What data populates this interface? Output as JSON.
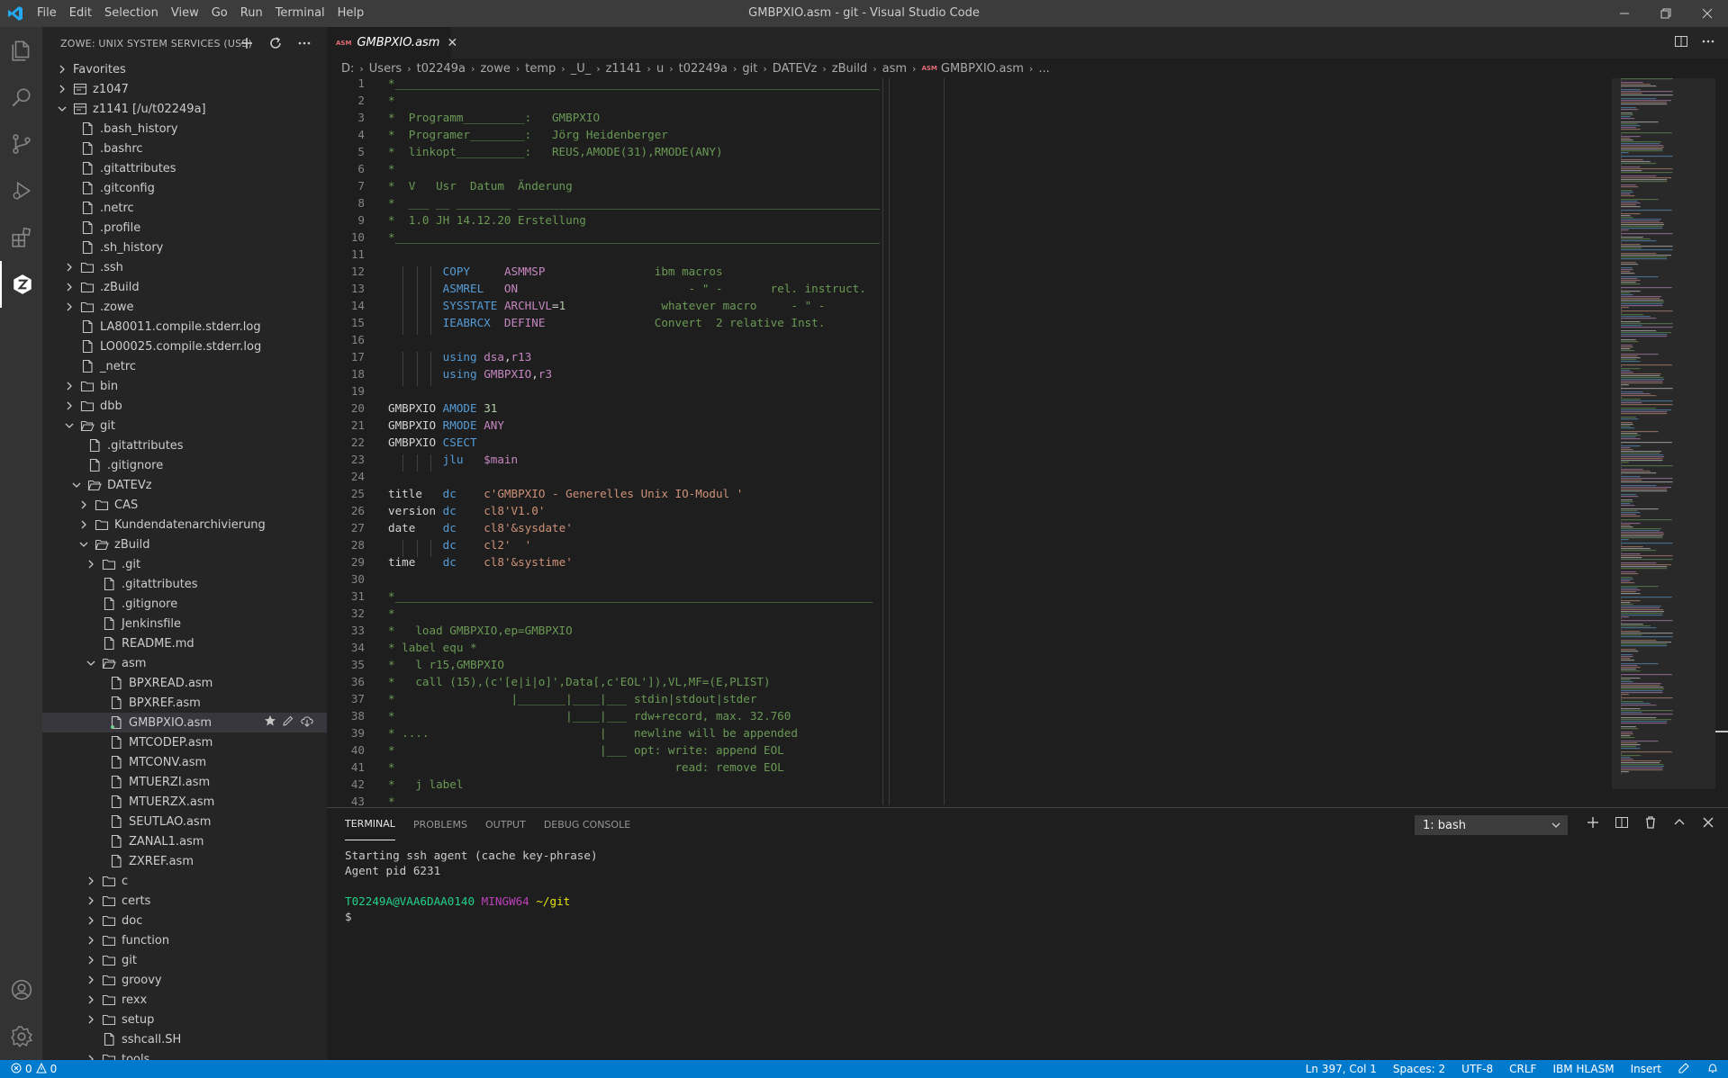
{
  "titlebar": {
    "window_title": "GMBPXIO.asm - git - Visual Studio Code",
    "menus": [
      "File",
      "Edit",
      "Selection",
      "View",
      "Go",
      "Run",
      "Terminal",
      "Help"
    ]
  },
  "activity_bar": {
    "icons": [
      "explorer-icon",
      "search-icon",
      "source-control-icon",
      "run-debug-icon",
      "extensions-icon",
      "zowe-icon"
    ],
    "bottom_icons": [
      "accounts-icon",
      "settings-gear-icon"
    ]
  },
  "sidebar": {
    "title": "ZOWE: UNIX SYSTEM SERVICES (USS)",
    "tree": [
      {
        "label": "Favorites",
        "kind": "folder-closed",
        "level": 0
      },
      {
        "label": "z1047",
        "kind": "profile-closed",
        "level": 0
      },
      {
        "label": "z1141 [/u/t02249a]",
        "kind": "profile-open",
        "level": 0
      },
      {
        "label": ".bash_history",
        "kind": "file",
        "level": 1
      },
      {
        "label": ".bashrc",
        "kind": "file",
        "level": 1
      },
      {
        "label": ".gitattributes",
        "kind": "file",
        "level": 1
      },
      {
        "label": ".gitconfig",
        "kind": "file",
        "level": 1
      },
      {
        "label": ".netrc",
        "kind": "file",
        "level": 1
      },
      {
        "label": ".profile",
        "kind": "file",
        "level": 1
      },
      {
        "label": ".sh_history",
        "kind": "file",
        "level": 1
      },
      {
        "label": ".ssh",
        "kind": "folder-closed",
        "level": 1
      },
      {
        "label": ".zBuild",
        "kind": "folder-closed",
        "level": 1
      },
      {
        "label": ".zowe",
        "kind": "folder-closed",
        "level": 1
      },
      {
        "label": "LA80011.compile.stderr.log",
        "kind": "file",
        "level": 1
      },
      {
        "label": "LO00025.compile.stderr.log",
        "kind": "file",
        "level": 1
      },
      {
        "label": "_netrc",
        "kind": "file",
        "level": 1
      },
      {
        "label": "bin",
        "kind": "folder-closed",
        "level": 1
      },
      {
        "label": "dbb",
        "kind": "folder-closed",
        "level": 1
      },
      {
        "label": "git",
        "kind": "folder-open",
        "level": 1
      },
      {
        "label": ".gitattributes",
        "kind": "file",
        "level": 2
      },
      {
        "label": ".gitignore",
        "kind": "file",
        "level": 2
      },
      {
        "label": "DATEVz",
        "kind": "folder-open",
        "level": 2
      },
      {
        "label": "CAS",
        "kind": "folder-closed",
        "level": 3
      },
      {
        "label": "Kundendatenarchivierung",
        "kind": "folder-closed",
        "level": 3
      },
      {
        "label": "zBuild",
        "kind": "folder-open",
        "level": 3
      },
      {
        "label": ".git",
        "kind": "folder-closed",
        "level": 4
      },
      {
        "label": ".gitattributes",
        "kind": "file",
        "level": 4
      },
      {
        "label": ".gitignore",
        "kind": "file",
        "level": 4
      },
      {
        "label": "Jenkinsfile",
        "kind": "file",
        "level": 4
      },
      {
        "label": "README.md",
        "kind": "file",
        "level": 4
      },
      {
        "label": "asm",
        "kind": "folder-open",
        "level": 4
      },
      {
        "label": "BPXREAD.asm",
        "kind": "file",
        "level": 5
      },
      {
        "label": "BPXREF.asm",
        "kind": "file",
        "level": 5
      },
      {
        "label": "GMBPXIO.asm",
        "kind": "file",
        "level": 5,
        "selected": true
      },
      {
        "label": "MTCODEP.asm",
        "kind": "file",
        "level": 5
      },
      {
        "label": "MTCONV.asm",
        "kind": "file",
        "level": 5
      },
      {
        "label": "MTUERZI.asm",
        "kind": "file",
        "level": 5
      },
      {
        "label": "MTUERZX.asm",
        "kind": "file",
        "level": 5
      },
      {
        "label": "SEUTLAO.asm",
        "kind": "file",
        "level": 5
      },
      {
        "label": "ZANAL1.asm",
        "kind": "file",
        "level": 5
      },
      {
        "label": "ZXREF.asm",
        "kind": "file",
        "level": 5
      },
      {
        "label": "c",
        "kind": "folder-closed",
        "level": 4
      },
      {
        "label": "certs",
        "kind": "folder-closed",
        "level": 4
      },
      {
        "label": "doc",
        "kind": "folder-closed",
        "level": 4
      },
      {
        "label": "function",
        "kind": "folder-closed",
        "level": 4
      },
      {
        "label": "git",
        "kind": "folder-closed",
        "level": 4
      },
      {
        "label": "groovy",
        "kind": "folder-closed",
        "level": 4
      },
      {
        "label": "rexx",
        "kind": "folder-closed",
        "level": 4
      },
      {
        "label": "setup",
        "kind": "folder-closed",
        "level": 4
      },
      {
        "label": "sshcall.SH",
        "kind": "file",
        "level": 4
      },
      {
        "label": "tools",
        "kind": "folder-closed",
        "level": 4
      }
    ]
  },
  "editor": {
    "tab": {
      "badge": "ASM",
      "label": "GMBPXIO.asm"
    },
    "breadcrumbs": [
      "D:",
      "Users",
      "t02249a",
      "zowe",
      "temp",
      "_U_",
      "z1141",
      "u",
      "t02249a",
      "git",
      "DATEVz",
      "zBuild",
      "asm",
      "GMBPXIO.asm",
      "..."
    ],
    "lines": [
      {
        "n": "1",
        "t": "*_______________________________________________________________________",
        "c": "com"
      },
      {
        "n": "2",
        "t": "*",
        "c": "com"
      },
      {
        "n": "3",
        "t": "*  Programm_________:   GMBPXIO",
        "c": "com"
      },
      {
        "n": "4",
        "t": "*  Programer________:   Jörg Heidenberger",
        "c": "com"
      },
      {
        "n": "5",
        "t": "*  linkopt__________:   REUS,AMODE(31),RMODE(ANY)",
        "c": "com"
      },
      {
        "n": "6",
        "t": "*",
        "c": "com"
      },
      {
        "n": "7",
        "t": "*  V   Usr  Datum  Änderung",
        "c": "com"
      },
      {
        "n": "8",
        "t": "*  ___ __ ________ _____________________________________________________",
        "c": "com"
      },
      {
        "n": "9",
        "t": "*  1.0 JH 14.12.20 Erstellung",
        "c": "com"
      },
      {
        "n": "10",
        "t": "*_______________________________________________________________________",
        "c": "com"
      },
      {
        "n": "11",
        "t": "",
        "c": "com"
      },
      {
        "n": "12",
        "parts": [
          [
            "        ",
            ""
          ],
          [
            "COPY",
            "kw"
          ],
          [
            "     ",
            ""
          ],
          [
            "ASMMSP",
            "op"
          ],
          [
            "                ",
            ""
          ],
          [
            "ibm macros",
            "com"
          ]
        ]
      },
      {
        "n": "13",
        "parts": [
          [
            "        ",
            ""
          ],
          [
            "ASMREL",
            "kw"
          ],
          [
            "   ",
            ""
          ],
          [
            "ON",
            "op"
          ],
          [
            "                      ",
            ""
          ],
          [
            "   - \" -       rel. instruct.",
            "com"
          ]
        ]
      },
      {
        "n": "14",
        "parts": [
          [
            "        ",
            ""
          ],
          [
            "SYSSTATE",
            "kw"
          ],
          [
            " ",
            ""
          ],
          [
            "ARCHLVL",
            "op"
          ],
          [
            "=",
            "lbl"
          ],
          [
            "1",
            "num"
          ],
          [
            "              ",
            ""
          ],
          [
            "whatever macro     - \" -",
            "com"
          ]
        ]
      },
      {
        "n": "15",
        "parts": [
          [
            "        ",
            ""
          ],
          [
            "IEABRCX",
            "kw"
          ],
          [
            "  ",
            ""
          ],
          [
            "DEFINE",
            "op"
          ],
          [
            "                ",
            ""
          ],
          [
            "Convert  2 relative Inst.",
            "com"
          ]
        ]
      },
      {
        "n": "16",
        "t": "",
        "c": "com"
      },
      {
        "n": "17",
        "parts": [
          [
            "        ",
            ""
          ],
          [
            "using",
            "kw"
          ],
          [
            " ",
            ""
          ],
          [
            "dsa",
            "op"
          ],
          [
            ",",
            "lbl"
          ],
          [
            "r13",
            "op"
          ]
        ]
      },
      {
        "n": "18",
        "parts": [
          [
            "        ",
            ""
          ],
          [
            "using",
            "kw"
          ],
          [
            " ",
            ""
          ],
          [
            "GMBPXIO",
            "op"
          ],
          [
            ",",
            "lbl"
          ],
          [
            "r3",
            "op"
          ]
        ]
      },
      {
        "n": "19",
        "t": "",
        "c": "com"
      },
      {
        "n": "20",
        "parts": [
          [
            "GMBPXIO",
            "lbl"
          ],
          [
            " ",
            ""
          ],
          [
            "AMODE",
            "kw"
          ],
          [
            " ",
            ""
          ],
          [
            "31",
            "num"
          ]
        ]
      },
      {
        "n": "21",
        "parts": [
          [
            "GMBPXIO",
            "lbl"
          ],
          [
            " ",
            ""
          ],
          [
            "RMODE",
            "kw"
          ],
          [
            " ",
            ""
          ],
          [
            "ANY",
            "op"
          ]
        ]
      },
      {
        "n": "22",
        "parts": [
          [
            "GMBPXIO",
            "lbl"
          ],
          [
            " ",
            ""
          ],
          [
            "CSECT",
            "kw"
          ]
        ]
      },
      {
        "n": "23",
        "parts": [
          [
            "        ",
            ""
          ],
          [
            "jlu",
            "kw"
          ],
          [
            "   ",
            ""
          ],
          [
            "$main",
            "op"
          ]
        ]
      },
      {
        "n": "24",
        "t": "",
        "c": "com"
      },
      {
        "n": "25",
        "parts": [
          [
            "title",
            "lbl"
          ],
          [
            "   ",
            ""
          ],
          [
            "dc",
            "kw"
          ],
          [
            "    ",
            ""
          ],
          [
            "c'GMBPXIO - Generelles Unix IO-Modul '",
            "str"
          ]
        ]
      },
      {
        "n": "26",
        "parts": [
          [
            "version",
            "lbl"
          ],
          [
            " ",
            ""
          ],
          [
            "dc",
            "kw"
          ],
          [
            "    ",
            ""
          ],
          [
            "cl8'V1.0'",
            "str"
          ]
        ]
      },
      {
        "n": "27",
        "parts": [
          [
            "date",
            "lbl"
          ],
          [
            "    ",
            ""
          ],
          [
            "dc",
            "kw"
          ],
          [
            "    ",
            ""
          ],
          [
            "cl8'&sysdate'",
            "str"
          ]
        ]
      },
      {
        "n": "28",
        "parts": [
          [
            "        ",
            ""
          ],
          [
            "dc",
            "kw"
          ],
          [
            "    ",
            ""
          ],
          [
            "cl2'  '",
            "str"
          ]
        ]
      },
      {
        "n": "29",
        "parts": [
          [
            "time",
            "lbl"
          ],
          [
            "    ",
            ""
          ],
          [
            "dc",
            "kw"
          ],
          [
            "    ",
            ""
          ],
          [
            "cl8'&systime'",
            "str"
          ]
        ]
      },
      {
        "n": "30",
        "t": "",
        "c": "com"
      },
      {
        "n": "31",
        "t": "*______________________________________________________________________",
        "c": "com"
      },
      {
        "n": "32",
        "t": "*",
        "c": "com"
      },
      {
        "n": "33",
        "t": "*   load GMBPXIO,ep=GMBPXIO",
        "c": "com"
      },
      {
        "n": "34",
        "t": "* label equ *",
        "c": "com"
      },
      {
        "n": "35",
        "t": "*   l r15,GMBPXIO",
        "c": "com"
      },
      {
        "n": "36",
        "t": "*   call (15),(c'[e|i|o]',Data[,c'EOL']),VL,MF=(E,PLIST)",
        "c": "com"
      },
      {
        "n": "37",
        "t": "*                 |_______|____|___ stdin|stdout|stder",
        "c": "com"
      },
      {
        "n": "38",
        "t": "*                         |____|___ rdw+record, max. 32.760",
        "c": "com"
      },
      {
        "n": "39",
        "t": "* ....                         |    newline will be appended",
        "c": "com"
      },
      {
        "n": "40",
        "t": "*                              |___ opt: write: append EOL",
        "c": "com"
      },
      {
        "n": "41",
        "t": "*                                         read: remove EOL",
        "c": "com"
      },
      {
        "n": "42",
        "t": "*   j label",
        "c": "com"
      },
      {
        "n": "43",
        "t": "*",
        "c": "com"
      }
    ]
  },
  "panel": {
    "tabs": [
      "TERMINAL",
      "PROBLEMS",
      "OUTPUT",
      "DEBUG CONSOLE"
    ],
    "active_tab": "TERMINAL",
    "terminal_select": "1: bash",
    "terminal": {
      "line1": "Starting ssh agent (cache key-phrase)",
      "line2": "Agent pid 6231",
      "prompt_user": "T02249A@VAA6DAA0140",
      "prompt_env": "MINGW64",
      "prompt_path": "~/git",
      "prompt_symbol": "$"
    }
  },
  "statusbar": {
    "errors": "0",
    "warnings": "0",
    "position": "Ln 397, Col 1",
    "spaces": "Spaces: 2",
    "encoding": "UTF-8",
    "eol": "CRLF",
    "language": "IBM HLASM",
    "mode": "Insert"
  },
  "colors": {
    "statusbar": "#007acc",
    "titlebar": "#3c3c3c",
    "activitybar": "#333333",
    "sidebar": "#252526",
    "editor": "#1e1e1e",
    "comment": "#6a9955",
    "keyword": "#569cd6",
    "operand": "#c586c0",
    "string": "#ce9178"
  }
}
